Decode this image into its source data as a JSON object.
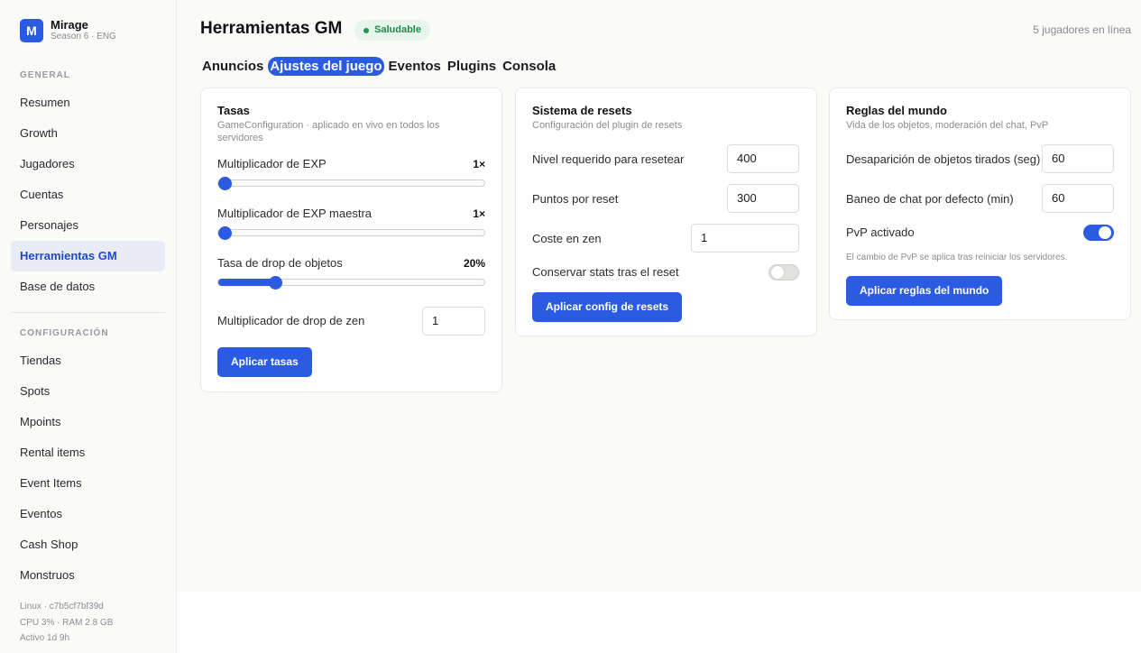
{
  "brand": {
    "logo_letter": "M",
    "name": "Mirage",
    "subtitle": "Season 6 · ENG"
  },
  "sidebar": {
    "section_general": "GENERAL",
    "general_items": [
      "Resumen",
      "Growth",
      "Jugadores",
      "Cuentas",
      "Personajes",
      "Herramientas GM",
      "Base de datos"
    ],
    "active_item": "Herramientas GM",
    "section_config": "CONFIGURACIÓN",
    "config_items": [
      "Tiendas",
      "Spots",
      "Mpoints",
      "Rental items",
      "Event Items",
      "Eventos",
      "Cash Shop",
      "Monstruos"
    ],
    "system": {
      "host": "Linux · c7b5cf7bf39d",
      "resources": "CPU 3% · RAM 2.8 GB",
      "uptime": "Activo 1d 9h"
    }
  },
  "header": {
    "title": "Herramientas GM",
    "status": "Saludable",
    "online": "5 jugadores en línea"
  },
  "tabs": [
    "Anuncios",
    "Ajustes del juego",
    "Eventos",
    "Plugins",
    "Consola"
  ],
  "active_tab": "Ajustes del juego",
  "rates": {
    "title": "Tasas",
    "subtitle": "GameConfiguration · aplicado en vivo en todos los servidores",
    "exp_label": "Multiplicador de EXP",
    "exp_value": "1×",
    "exp_fraction": 0.0,
    "master_exp_label": "Multiplicador de EXP maestra",
    "master_exp_value": "1×",
    "master_exp_fraction": 0.0,
    "drop_label": "Tasa de drop de objetos",
    "drop_value": "20%",
    "drop_fraction": 0.2,
    "zen_label": "Multiplicador de drop de zen",
    "zen_value": "1",
    "apply_label": "Aplicar tasas"
  },
  "resets": {
    "title": "Sistema de resets",
    "subtitle": "Configuración del plugin de resets",
    "level_label": "Nivel requerido para resetear",
    "level_value": "400",
    "points_label": "Puntos por reset",
    "points_value": "300",
    "zen_label": "Coste en zen",
    "zen_value": "1",
    "keep_stats_label": "Conservar stats tras el reset",
    "keep_stats_on": false,
    "apply_label": "Aplicar config de resets"
  },
  "world": {
    "title": "Reglas del mundo",
    "subtitle": "Vida de los objetos, moderación del chat, PvP",
    "drop_despawn_label": "Desaparición de objetos tirados (seg)",
    "drop_despawn_value": "60",
    "chat_ban_label": "Baneo de chat por defecto (min)",
    "chat_ban_value": "60",
    "pvp_label": "PvP activado",
    "pvp_on": true,
    "pvp_note": "El cambio de PvP se aplica tras reiniciar los servidores.",
    "apply_label": "Aplicar reglas del mundo"
  },
  "colors": {
    "accent": "#2c5be3",
    "healthy_bg": "#e8f5ec",
    "healthy_text": "#1d8a49"
  }
}
